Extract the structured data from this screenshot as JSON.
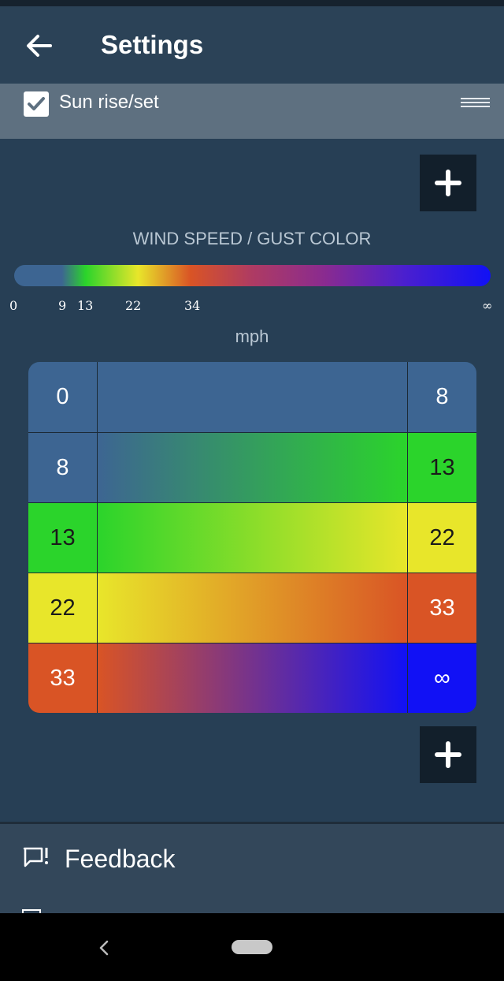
{
  "app_bar": {
    "title": "Settings",
    "back_icon": "arrow-left-icon"
  },
  "sun_row": {
    "label": "Sun rise/set",
    "checked": true
  },
  "legend": {
    "title": "WIND SPEED / GUST COLOR",
    "ticks": [
      "0",
      "9",
      "13",
      "22",
      "34",
      "∞"
    ],
    "unit": "mph"
  },
  "color_table": {
    "rows": [
      {
        "from": "0",
        "to": "8",
        "from_color": "#3d6592",
        "to_color": "#3d6592"
      },
      {
        "from": "8",
        "to": "13",
        "from_color": "#3d6592",
        "to_color": "#2bd42b"
      },
      {
        "from": "13",
        "to": "22",
        "from_color": "#2bd42b",
        "to_color": "#e8e62a"
      },
      {
        "from": "22",
        "to": "33",
        "from_color": "#e8e62a",
        "to_color": "#d95425"
      },
      {
        "from": "33",
        "to": "∞",
        "from_color": "#d95425",
        "to_color": "#1111f5"
      }
    ]
  },
  "buttons": {
    "add_icon": "plus-icon"
  },
  "bottom_list": {
    "feedback_label": "Feedback",
    "feedback_icon": "feedback-icon",
    "legal_icon": "document-icon"
  },
  "nav": {
    "back_icon": "chevron-left-icon",
    "home_icon": "home-pill-icon"
  }
}
